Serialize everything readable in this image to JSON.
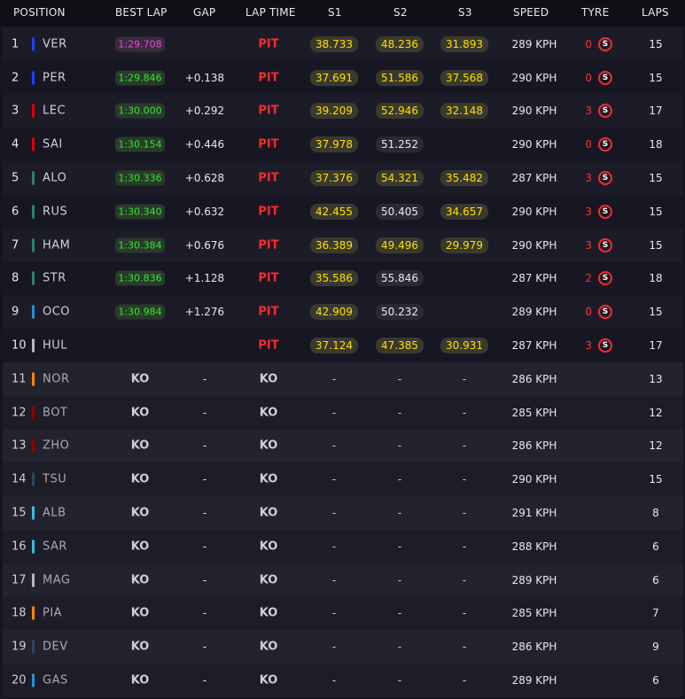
{
  "header": {
    "position": "POSITION",
    "best_lap": "BEST LAP",
    "gap": "GAP",
    "lap_time": "LAP TIME",
    "s1": "S1",
    "s2": "S2",
    "s3": "S3",
    "speed": "SPEED",
    "tyre": "TYRE",
    "laps": "LAPS"
  },
  "colors": {
    "red_bull": "#1e41ff",
    "ferrari": "#dc0000",
    "aston": "#2d826d",
    "mercedes": "#27f4d2",
    "alpine": "#2293d1",
    "haas": "#b6babd",
    "mclaren": "#ff8700",
    "alfa": "#900000",
    "alphatauri": "#2b4562",
    "williams": "#37bedd",
    "pit": "#ff2a2a",
    "fastest": "#32e832",
    "overall": "#e24ae2",
    "sector": "#ffe000"
  },
  "rows": [
    {
      "pos": "1",
      "team": "red_bull",
      "driver": "VER",
      "best": "1:29.708",
      "best_style": "purple",
      "gap": "",
      "lap": "PIT",
      "s1": "38.733",
      "s1c": "y",
      "s2": "48.236",
      "s2c": "y",
      "s3": "31.893",
      "s3c": "y",
      "speed": "289 KPH",
      "tyre_count": "0",
      "tyre": "S",
      "laps": "15"
    },
    {
      "pos": "2",
      "team": "red_bull",
      "driver": "PER",
      "best": "1:29.846",
      "best_style": "green",
      "gap": "+0.138",
      "lap": "PIT",
      "s1": "37.691",
      "s1c": "y",
      "s2": "51.586",
      "s2c": "y",
      "s3": "37.568",
      "s3c": "y",
      "speed": "290 KPH",
      "tyre_count": "0",
      "tyre": "S",
      "laps": "15"
    },
    {
      "pos": "3",
      "team": "ferrari",
      "driver": "LEC",
      "best": "1:30.000",
      "best_style": "green",
      "gap": "+0.292",
      "lap": "PIT",
      "s1": "39.209",
      "s1c": "y",
      "s2": "52.946",
      "s2c": "y",
      "s3": "32.148",
      "s3c": "y",
      "speed": "290 KPH",
      "tyre_count": "3",
      "tyre": "S",
      "laps": "17"
    },
    {
      "pos": "4",
      "team": "ferrari",
      "driver": "SAI",
      "best": "1:30.154",
      "best_style": "green",
      "gap": "+0.446",
      "lap": "PIT",
      "s1": "37.978",
      "s1c": "y",
      "s2": "51.252",
      "s2c": "w",
      "s3": "",
      "s3c": "",
      "speed": "290 KPH",
      "tyre_count": "0",
      "tyre": "S",
      "laps": "18"
    },
    {
      "pos": "5",
      "team": "aston",
      "driver": "ALO",
      "best": "1:30.336",
      "best_style": "green",
      "gap": "+0.628",
      "lap": "PIT",
      "s1": "37.376",
      "s1c": "y",
      "s2": "54.321",
      "s2c": "y",
      "s3": "35.482",
      "s3c": "y",
      "speed": "287 KPH",
      "tyre_count": "3",
      "tyre": "S",
      "laps": "15"
    },
    {
      "pos": "6",
      "team": "aston",
      "driver": "RUS",
      "best": "1:30.340",
      "best_style": "green",
      "gap": "+0.632",
      "lap": "PIT",
      "s1": "42.455",
      "s1c": "y",
      "s2": "50.405",
      "s2c": "w",
      "s3": "34.657",
      "s3c": "y",
      "speed": "290 KPH",
      "tyre_count": "3",
      "tyre": "S",
      "laps": "15"
    },
    {
      "pos": "7",
      "team": "aston",
      "driver": "HAM",
      "best": "1:30.384",
      "best_style": "green",
      "gap": "+0.676",
      "lap": "PIT",
      "s1": "36.389",
      "s1c": "y",
      "s2": "49.496",
      "s2c": "y",
      "s3": "29.979",
      "s3c": "y",
      "speed": "290 KPH",
      "tyre_count": "3",
      "tyre": "S",
      "laps": "15"
    },
    {
      "pos": "8",
      "team": "aston",
      "driver": "STR",
      "best": "1:30.836",
      "best_style": "green",
      "gap": "+1.128",
      "lap": "PIT",
      "s1": "35.586",
      "s1c": "y",
      "s2": "55.846",
      "s2c": "w",
      "s3": "",
      "s3c": "",
      "speed": "287 KPH",
      "tyre_count": "2",
      "tyre": "S",
      "laps": "18"
    },
    {
      "pos": "9",
      "team": "alpine",
      "driver": "OCO",
      "best": "1:30.984",
      "best_style": "green",
      "gap": "+1.276",
      "lap": "PIT",
      "s1": "42.909",
      "s1c": "y",
      "s2": "50.232",
      "s2c": "w",
      "s3": "",
      "s3c": "",
      "speed": "289 KPH",
      "tyre_count": "0",
      "tyre": "S",
      "laps": "15"
    },
    {
      "pos": "10",
      "team": "haas",
      "driver": "HUL",
      "best": "",
      "best_style": "none",
      "gap": "",
      "lap": "PIT",
      "s1": "37.124",
      "s1c": "y",
      "s2": "47.385",
      "s2c": "y",
      "s3": "30.931",
      "s3c": "y",
      "speed": "287 KPH",
      "tyre_count": "3",
      "tyre": "S",
      "laps": "17"
    },
    {
      "pos": "11",
      "team": "mclaren",
      "driver": "NOR",
      "best": "KO",
      "best_style": "ko",
      "gap": "-",
      "lap": "KO",
      "s1": "-",
      "s1c": "plain",
      "s2": "-",
      "s2c": "plain",
      "s3": "-",
      "s3c": "plain",
      "speed": "286 KPH",
      "tyre_count": "",
      "tyre": "",
      "laps": "13"
    },
    {
      "pos": "12",
      "team": "alfa",
      "driver": "BOT",
      "best": "KO",
      "best_style": "ko",
      "gap": "-",
      "lap": "KO",
      "s1": "-",
      "s1c": "plain",
      "s2": "-",
      "s2c": "plain",
      "s3": "-",
      "s3c": "plain",
      "speed": "285 KPH",
      "tyre_count": "",
      "tyre": "",
      "laps": "12"
    },
    {
      "pos": "13",
      "team": "alfa",
      "driver": "ZHO",
      "best": "KO",
      "best_style": "ko",
      "gap": "-",
      "lap": "KO",
      "s1": "-",
      "s1c": "plain",
      "s2": "-",
      "s2c": "plain",
      "s3": "-",
      "s3c": "plain",
      "speed": "286 KPH",
      "tyre_count": "",
      "tyre": "",
      "laps": "12"
    },
    {
      "pos": "14",
      "team": "alphatauri",
      "driver": "TSU",
      "best": "KO",
      "best_style": "ko",
      "gap": "-",
      "lap": "KO",
      "s1": "-",
      "s1c": "plain",
      "s2": "-",
      "s2c": "plain",
      "s3": "-",
      "s3c": "plain",
      "speed": "290 KPH",
      "tyre_count": "",
      "tyre": "",
      "laps": "15"
    },
    {
      "pos": "15",
      "team": "williams",
      "driver": "ALB",
      "best": "KO",
      "best_style": "ko",
      "gap": "-",
      "lap": "KO",
      "s1": "-",
      "s1c": "plain",
      "s2": "-",
      "s2c": "plain",
      "s3": "-",
      "s3c": "plain",
      "speed": "291 KPH",
      "tyre_count": "",
      "tyre": "",
      "laps": "8"
    },
    {
      "pos": "16",
      "team": "williams",
      "driver": "SAR",
      "best": "KO",
      "best_style": "ko",
      "gap": "-",
      "lap": "KO",
      "s1": "-",
      "s1c": "plain",
      "s2": "-",
      "s2c": "plain",
      "s3": "-",
      "s3c": "plain",
      "speed": "288 KPH",
      "tyre_count": "",
      "tyre": "",
      "laps": "6"
    },
    {
      "pos": "17",
      "team": "haas",
      "driver": "MAG",
      "best": "KO",
      "best_style": "ko",
      "gap": "-",
      "lap": "KO",
      "s1": "-",
      "s1c": "plain",
      "s2": "-",
      "s2c": "plain",
      "s3": "-",
      "s3c": "plain",
      "speed": "289 KPH",
      "tyre_count": "",
      "tyre": "",
      "laps": "6"
    },
    {
      "pos": "18",
      "team": "mclaren",
      "driver": "PIA",
      "best": "KO",
      "best_style": "ko",
      "gap": "-",
      "lap": "KO",
      "s1": "-",
      "s1c": "plain",
      "s2": "-",
      "s2c": "plain",
      "s3": "-",
      "s3c": "plain",
      "speed": "285 KPH",
      "tyre_count": "",
      "tyre": "",
      "laps": "7"
    },
    {
      "pos": "19",
      "team": "alphatauri",
      "driver": "DEV",
      "best": "KO",
      "best_style": "ko",
      "gap": "-",
      "lap": "KO",
      "s1": "-",
      "s1c": "plain",
      "s2": "-",
      "s2c": "plain",
      "s3": "-",
      "s3c": "plain",
      "speed": "286 KPH",
      "tyre_count": "",
      "tyre": "",
      "laps": "9"
    },
    {
      "pos": "20",
      "team": "alpine",
      "driver": "GAS",
      "best": "KO",
      "best_style": "ko",
      "gap": "-",
      "lap": "KO",
      "s1": "-",
      "s1c": "plain",
      "s2": "-",
      "s2c": "plain",
      "s3": "-",
      "s3c": "plain",
      "speed": "289 KPH",
      "tyre_count": "",
      "tyre": "",
      "laps": "6"
    }
  ]
}
